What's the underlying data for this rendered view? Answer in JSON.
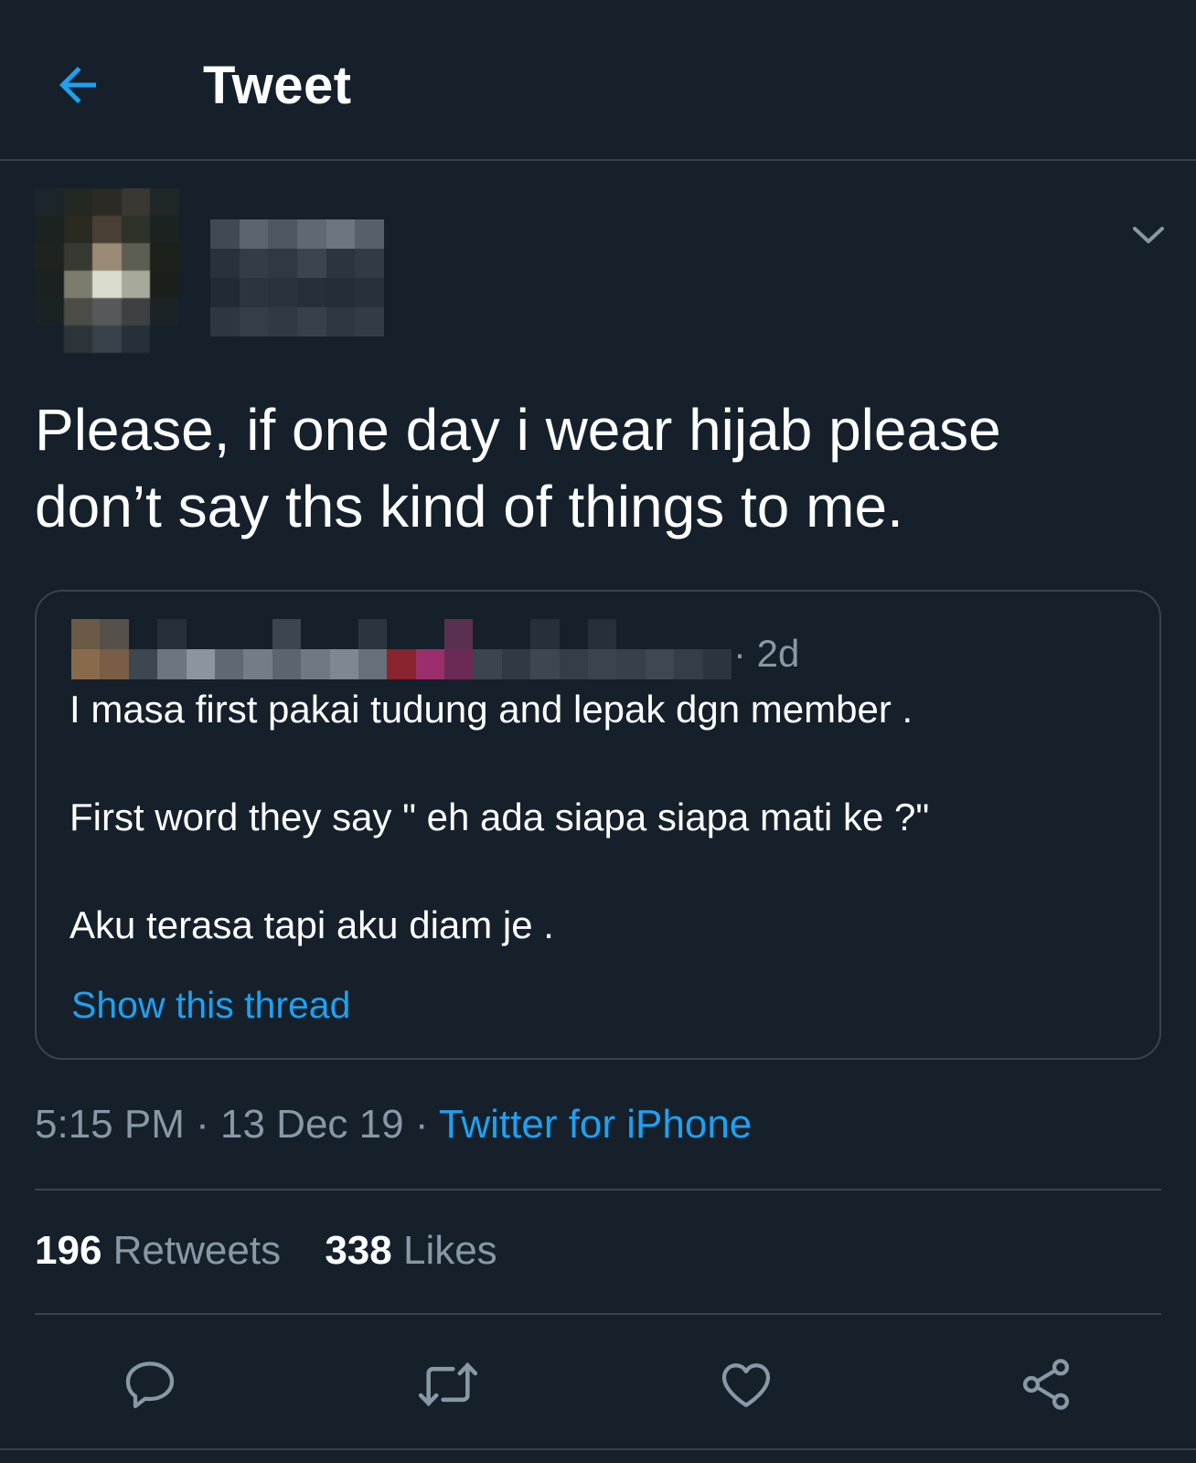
{
  "header": {
    "title": "Tweet",
    "back_icon": "arrow-left-icon"
  },
  "tweet": {
    "text": "Please, if one day i wear hijab please\ndon’t say ths kind of things to me.",
    "more_icon": "chevron-down-icon",
    "time": "5:15 PM",
    "date": "13 Dec 19",
    "separator": "·",
    "source": "Twitter for iPhone",
    "retweets_count": "196",
    "retweets_label": "Retweets",
    "likes_count": "338",
    "likes_label": "Likes"
  },
  "quote": {
    "time": "· 2d",
    "lines": [
      "I masa first pakai tudung and lepak dgn member .",
      "First word they say \" eh ada siapa siapa mati ke ?\"",
      "Aku terasa tapi aku diam je ."
    ],
    "show_thread": "Show this thread"
  },
  "actions": {
    "reply_icon": "reply-icon",
    "retweet_icon": "retweet-icon",
    "like_icon": "heart-icon",
    "share_icon": "share-icon"
  },
  "colors": {
    "background": "#15202b",
    "border": "#38444d",
    "accent": "#1da1f2",
    "secondary_text": "#8899a6",
    "primary_text": "#ffffff"
  }
}
